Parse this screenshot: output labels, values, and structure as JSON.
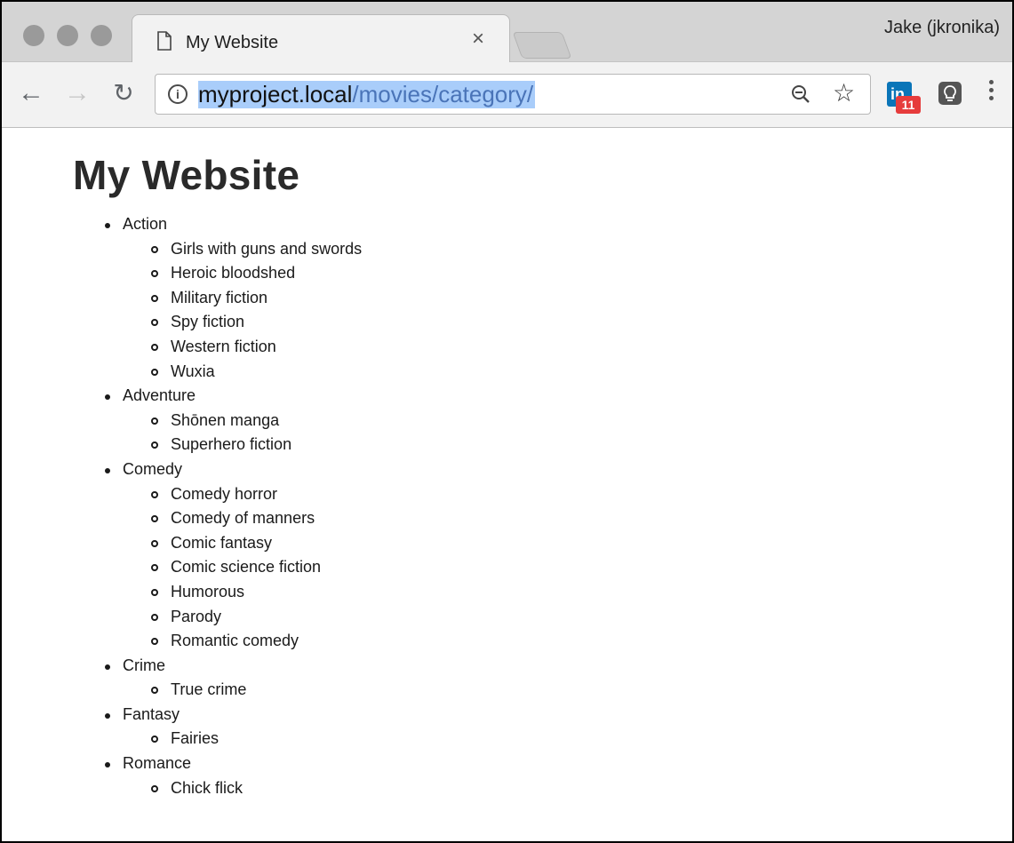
{
  "browser": {
    "tab_title": "My Website",
    "tab_close": "×",
    "profile_name": "Jake (jkronika)",
    "url_host": "myproject.local",
    "url_path": "/movies/category/",
    "extension_badge": "11"
  },
  "page": {
    "heading": "My Website",
    "categories": [
      {
        "name": "Action",
        "subcategories": [
          "Girls with guns and swords",
          "Heroic bloodshed",
          "Military fiction",
          "Spy fiction",
          "Western fiction",
          "Wuxia"
        ]
      },
      {
        "name": "Adventure",
        "subcategories": [
          "Shōnen manga",
          "Superhero fiction"
        ]
      },
      {
        "name": "Comedy",
        "subcategories": [
          "Comedy horror",
          "Comedy of manners",
          "Comic fantasy",
          "Comic science fiction",
          "Humorous",
          "Parody",
          "Romantic comedy"
        ]
      },
      {
        "name": "Crime",
        "subcategories": [
          "True crime"
        ]
      },
      {
        "name": "Fantasy",
        "subcategories": [
          "Fairies"
        ]
      },
      {
        "name": "Romance",
        "subcategories": [
          "Chick flick"
        ]
      }
    ]
  },
  "colors": {
    "url_highlight": "#a9cdfa",
    "url_path": "#4a74b8",
    "linkedin": "#0a75b8",
    "badge": "#e63c3c"
  },
  "icons": [
    "page-icon",
    "close-icon",
    "back-arrow-icon",
    "forward-arrow-icon",
    "reload-icon",
    "info-icon",
    "zoom-out-icon",
    "bookmark-star-icon",
    "linkedin-extension-icon",
    "lightbulb-extension-icon",
    "menu-dots-icon"
  ]
}
